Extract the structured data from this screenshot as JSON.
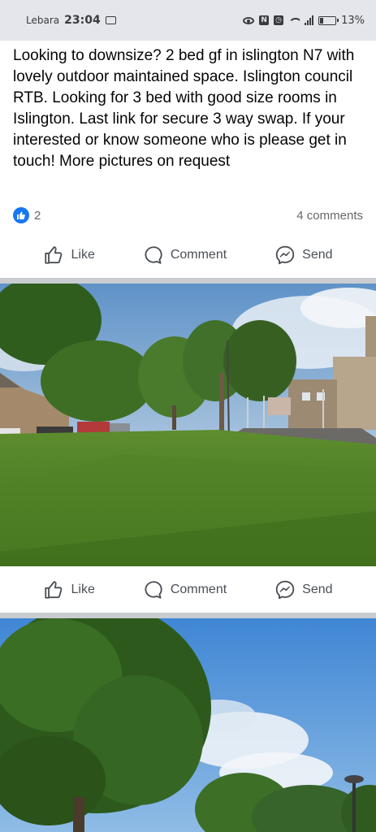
{
  "status_bar": {
    "carrier": "Lebara",
    "time": "23:04",
    "battery": "13%"
  },
  "post": {
    "text": "Looking to downsize? 2 bed gf in islington N7 with lovely  outdoor maintained space. Islington council RTB. Looking for 3 bed with good size rooms in Islington. Last link for secure 3 way swap. If your interested or know someone who is please get in touch! More pictures on request",
    "reaction_count": "2",
    "comments_count": "4 comments"
  },
  "actions": {
    "like": "Like",
    "comment": "Comment",
    "send": "Send"
  },
  "colors": {
    "accent": "#1877f2",
    "divider": "#c9ccd1",
    "status_bar": "#e4e6eb"
  },
  "icons": [
    "message-icon",
    "eye-icon",
    "nfc-icon",
    "alarm-icon",
    "wifi-icon",
    "signal-icon",
    "battery-icon",
    "like-reaction-icon",
    "thumbs-up-icon",
    "comment-bubble-icon",
    "messenger-icon"
  ]
}
